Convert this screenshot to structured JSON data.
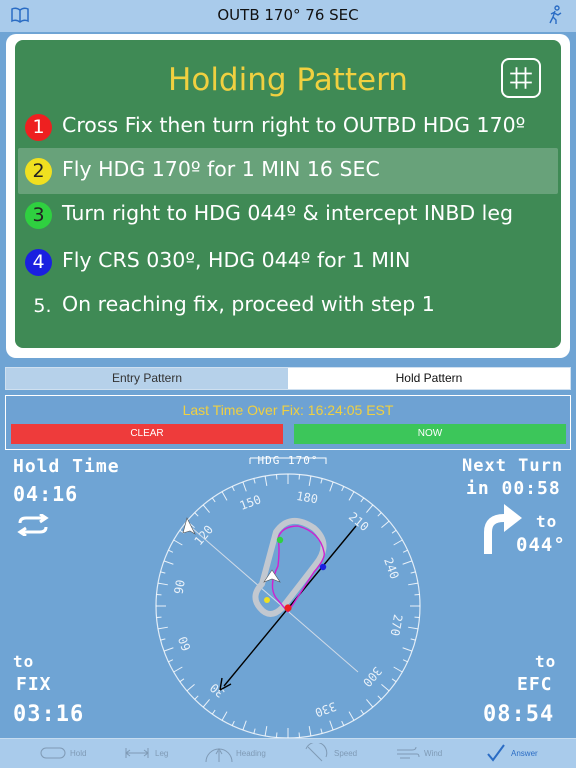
{
  "topbar": {
    "title": "OUTB 170°  76 SEC",
    "left_icon": "book-icon",
    "right_icon": "walking-person-icon"
  },
  "board": {
    "heading": "Holding Pattern",
    "grid_icon": "hashtag-grid-icon",
    "steps": [
      {
        "num": "1",
        "text": "Cross Fix then turn right to OUTBD HDG 170º",
        "color": "#ee2020"
      },
      {
        "num": "2",
        "text": "Fly HDG 170º for 1 MIN 16 SEC",
        "color": "#f0e020"
      },
      {
        "num": "3",
        "text": "Turn right to HDG 044º & intercept INBD leg",
        "color": "#2fd040"
      },
      {
        "num": "4",
        "text": "Fly CRS 030º, HDG 044º for 1 MIN",
        "color": "#1a20e0"
      },
      {
        "num": "5.",
        "text": "On reaching fix, proceed with step 1",
        "color": ""
      }
    ]
  },
  "tabs": {
    "entry": "Entry Pattern",
    "hold": "Hold Pattern"
  },
  "timer": {
    "last_time_label": "Last Time Over Fix:  16:24:05 EST",
    "clear_label": "CLEAR",
    "now_label": "NOW"
  },
  "hold": {
    "label": "Hold  Time",
    "value": "04:16",
    "icon": "repeat-arrows-icon"
  },
  "next_turn": {
    "line1": "Next Turn",
    "line2": "in 00:58",
    "to": "to",
    "heading": "044°",
    "icon": "turn-right-arrow-icon"
  },
  "to_fix": {
    "to": "to",
    "label": "FIX",
    "value": "03:16"
  },
  "efc": {
    "to": "to",
    "label": "EFC",
    "value": "08:54"
  },
  "compass": {
    "heading_label": "HDG 170°",
    "numbers": [
      "150",
      "180",
      "210",
      "240",
      "270",
      "300",
      "330",
      "30",
      "60",
      "90",
      "120"
    ]
  },
  "tabbar": {
    "items": [
      {
        "label": "Hold",
        "icon": "hold-oval-icon"
      },
      {
        "label": "Leg",
        "icon": "leg-length-icon"
      },
      {
        "label": "Heading",
        "icon": "heading-gauge-icon"
      },
      {
        "label": "Speed",
        "icon": "speed-gauge-icon"
      },
      {
        "label": "Wind",
        "icon": "wind-icon"
      },
      {
        "label": "Answer",
        "icon": "checkmark-icon"
      }
    ]
  },
  "colors": {
    "background": "#6fa4d4",
    "board": "#3f8a55",
    "heading": "#f0d040",
    "clear": "#ee3b3b",
    "now": "#3cc65a"
  }
}
